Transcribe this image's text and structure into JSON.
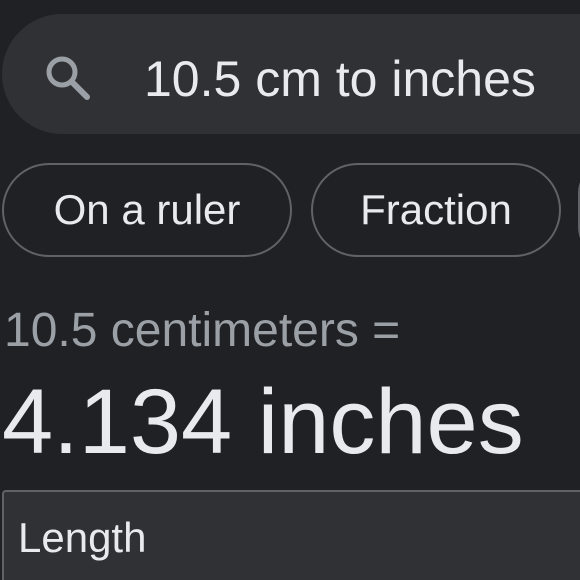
{
  "search": {
    "query": "10.5 cm to inches",
    "icon": "search-icon"
  },
  "chips": [
    {
      "label": "On a ruler"
    },
    {
      "label": "Fraction"
    }
  ],
  "conversion": {
    "equation": "10.5 centimeters =",
    "result": "4.134 inches"
  },
  "unit_type": {
    "label": "Length"
  },
  "colors": {
    "background": "#202124",
    "surface": "#303134",
    "text_primary": "#e8eaed",
    "text_secondary": "#9aa0a6",
    "outline": "#5f6368"
  }
}
